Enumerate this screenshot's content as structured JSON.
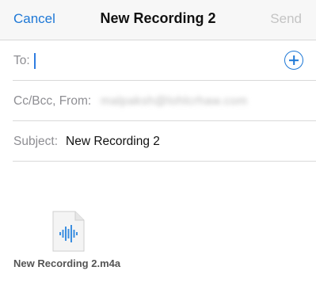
{
  "nav": {
    "cancel_label": "Cancel",
    "title": "New Recording 2",
    "send_label": "Send"
  },
  "to": {
    "label": "To:",
    "value": "",
    "add_icon": "plus-circle-icon"
  },
  "cc_from": {
    "label": "Cc/Bcc, From:",
    "value_blurred": "malpaksh@lohlcrhaw.com"
  },
  "subject": {
    "label": "Subject:",
    "value": "New Recording 2"
  },
  "attachment": {
    "icon": "audio-file-icon",
    "filename": "New Recording 2.m4a"
  },
  "colors": {
    "accent": "#1e78d6",
    "disabled": "#c4c4c4",
    "label": "#8e8e93"
  }
}
